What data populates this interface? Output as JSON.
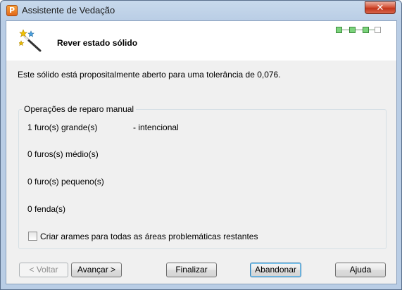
{
  "window": {
    "title": "Assistente de Vedação",
    "app_icon_letter": "P",
    "close_glyph": "✕"
  },
  "header": {
    "title": "Rever estado sólido",
    "progress": {
      "total_steps": 4,
      "completed_steps": 3
    }
  },
  "description": "Este sólido está propositalmente aberto para uma tolerância de 0,076.",
  "repair_group": {
    "title": "Operações de reparo manual",
    "operations": [
      {
        "label": "1 furo(s) grande(s)",
        "status": "- intencional"
      },
      {
        "label": "0 furos(s) médio(s)",
        "status": ""
      },
      {
        "label": "0 furo(s) pequeno(s)",
        "status": ""
      },
      {
        "label": "0 fenda(s)",
        "status": ""
      }
    ],
    "checkbox_label": "Criar arames para todas as áreas problemáticas restantes",
    "checkbox_checked": false
  },
  "buttons": {
    "back": "< Voltar",
    "next": "Avançar >",
    "finish": "Finalizar",
    "abandon": "Abandonar",
    "help": "Ajuda"
  },
  "colors": {
    "client_bg": "#f0f0f0",
    "frame": "#b9cde5",
    "progress_done": "#7bd37b"
  }
}
